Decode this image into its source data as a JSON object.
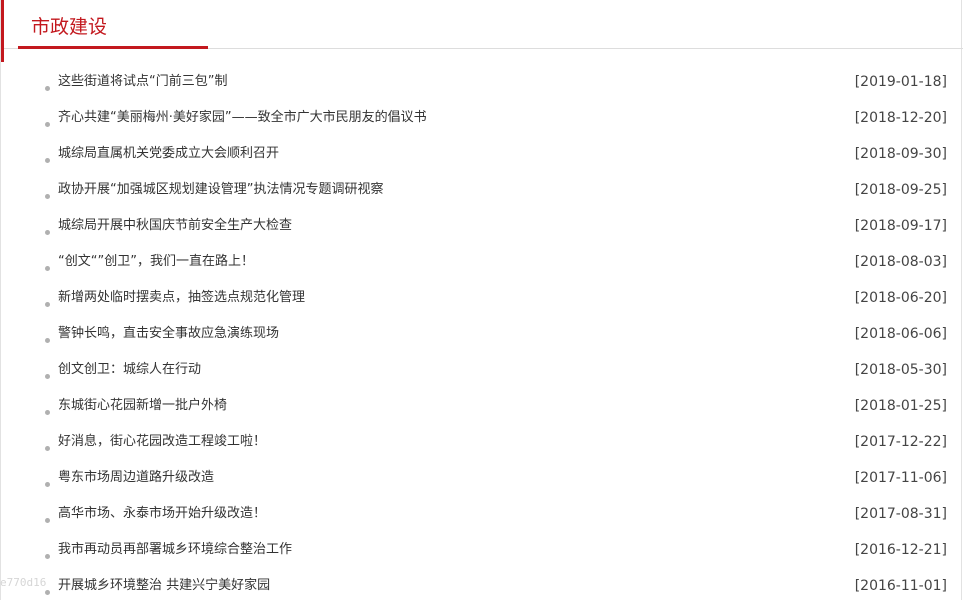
{
  "section": {
    "title": "市政建设",
    "watermark": "e770d16"
  },
  "news": [
    {
      "title": "这些街道将试点“门前三包”制",
      "date": "[2019-01-18]"
    },
    {
      "title": "齐心共建“美丽梅州·美好家园”——致全市广大市民朋友的倡议书",
      "date": "[2018-12-20]"
    },
    {
      "title": "城综局直属机关党委成立大会顺利召开",
      "date": "[2018-09-30]"
    },
    {
      "title": "政协开展“加强城区规划建设管理”执法情况专题调研视察",
      "date": "[2018-09-25]"
    },
    {
      "title": "城综局开展中秋国庆节前安全生产大检查",
      "date": "[2018-09-17]"
    },
    {
      "title": "“创文“”创卫”，我们一直在路上！",
      "date": "[2018-08-03]"
    },
    {
      "title": "新增两处临时摆卖点，抽签选点规范化管理",
      "date": "[2018-06-20]"
    },
    {
      "title": "警钟长鸣，直击安全事故应急演练现场",
      "date": "[2018-06-06]"
    },
    {
      "title": "创文创卫：城综人在行动",
      "date": "[2018-05-30]"
    },
    {
      "title": "东城街心花园新增一批户外椅",
      "date": "[2018-01-25]"
    },
    {
      "title": "好消息，街心花园改造工程竣工啦！",
      "date": "[2017-12-22]"
    },
    {
      "title": "粤东市场周边道路升级改造",
      "date": "[2017-11-06]"
    },
    {
      "title": "高华市场、永泰市场开始升级改造！",
      "date": "[2017-08-31]"
    },
    {
      "title": "我市再动员再部署城乡环境综合整治工作",
      "date": "[2016-12-21]"
    },
    {
      "title": "开展城乡环境整治 共建兴宁美好家园",
      "date": "[2016-11-01]"
    }
  ],
  "colors": {
    "accent": "#c3181e",
    "text": "#333333",
    "bullet": "#b0b0b0"
  }
}
